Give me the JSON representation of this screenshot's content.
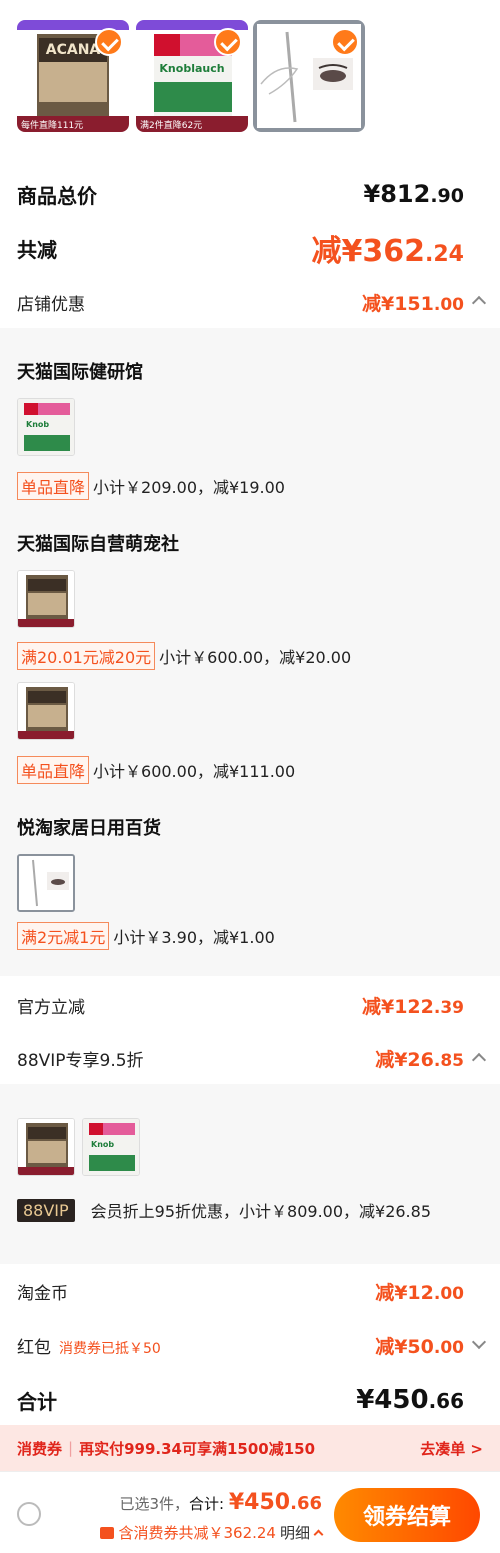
{
  "selected_products": [
    {
      "name": "ACANA Wild Prairie",
      "badge": "每件直降111元",
      "brand": "ACANA"
    },
    {
      "name": "Doppelherz Knoblauch",
      "badge": "满2件直降62元",
      "brand": "Knoblauch"
    },
    {
      "name": "Eyebrow pencil",
      "badge": "",
      "brand": ""
    }
  ],
  "summary": {
    "total_label": "商品总价",
    "total_int": "¥812",
    "total_dec": ".90",
    "reduce_label": "共减",
    "reduce_int": "减¥362",
    "reduce_dec": ".24",
    "shop_discount_label": "店铺优惠",
    "shop_discount_int": "减¥151",
    "shop_discount_dec": ".00"
  },
  "shops": [
    {
      "name": "天猫国际健研馆",
      "promos": [
        {
          "tag": "单品直降",
          "text": "小计￥209.00，减¥19.00"
        }
      ]
    },
    {
      "name": "天猫国际自营萌宠社",
      "promos": [
        {
          "tag": "满20.01元减20元",
          "text": "小计￥600.00，减¥20.00"
        },
        {
          "tag": "单品直降",
          "text": "小计￥600.00，减¥111.00"
        }
      ]
    },
    {
      "name": "悦淘家居日用百货",
      "promos": [
        {
          "tag": "满2元减1元",
          "text": "小计￥3.90，减¥1.00"
        }
      ]
    }
  ],
  "official": {
    "label": "官方立减",
    "int": "减¥122",
    "dec": ".39"
  },
  "vip": {
    "label": "88VIP专享9.5折",
    "int": "减¥26",
    "dec": ".85",
    "tag": "88VIP",
    "text": "会员折上95折优惠，小计￥809.00，减¥26.85"
  },
  "coins": {
    "label": "淘金币",
    "int": "减¥12",
    "dec": ".00"
  },
  "redpacket": {
    "label": "红包",
    "sub": "消费券已抵￥50",
    "int": "减¥50",
    "dec": ".00"
  },
  "grand": {
    "label": "合计",
    "int": "¥450",
    "dec": ".66"
  },
  "banner": {
    "title": "消费券",
    "text": "再实付999.34可享满1500减150",
    "action": "去凑单 >"
  },
  "footer": {
    "selected": "已选3件，",
    "total_label": "合计: ",
    "total_int": "¥450",
    "total_dec": ".66",
    "coupon_text": "含消费券共减￥362.24",
    "detail": "明细",
    "checkout": "领券结算"
  },
  "colors": {
    "accent": "#f4511e",
    "orange": "#ff7a1a"
  }
}
